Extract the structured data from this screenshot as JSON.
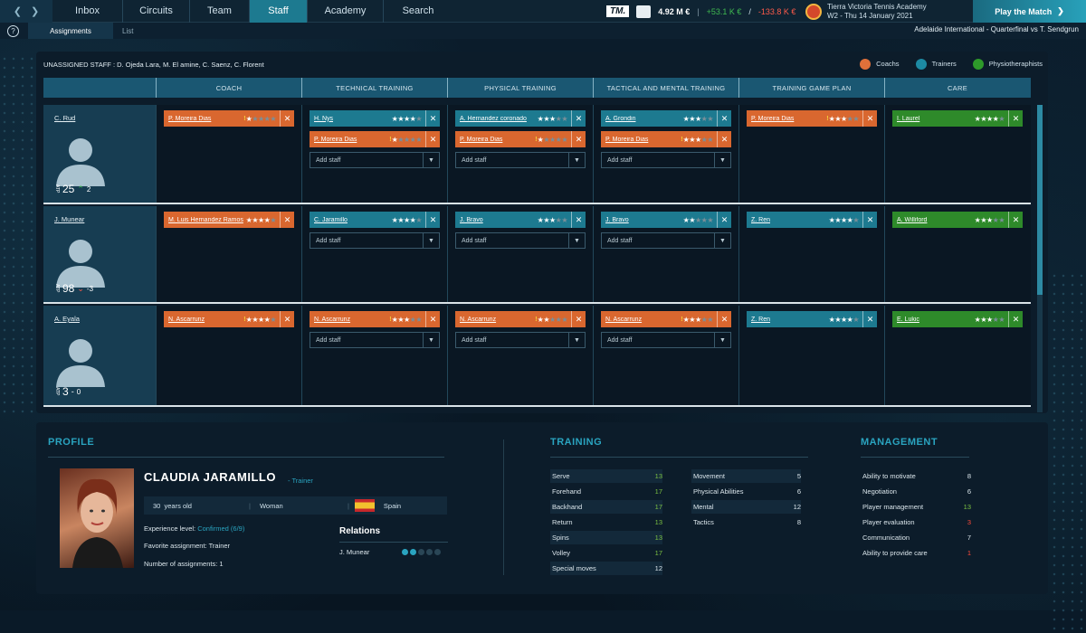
{
  "nav": {
    "tabs": [
      "Inbox",
      "Circuits",
      "Team",
      "Staff",
      "Academy",
      "Search"
    ],
    "active": "Staff"
  },
  "finance": {
    "logo": "TM.",
    "balance": "4.92 M €",
    "gain": "+53.1 K €",
    "separator": "/",
    "loss": "-133.8 K €"
  },
  "academy": {
    "name": "Tierra Victoria Tennis Academy",
    "date": "W2 - Thu 14 January 2021"
  },
  "play_button": "Play the Match",
  "subnav": {
    "help": "?",
    "tabs": [
      "Assignments",
      "List"
    ],
    "active": "Assignments"
  },
  "match_info": "Adelaide International - Quarterfinal vs T. Sendgrun",
  "unassigned": "UNASSIGNED STAFF : D. Ojeda Lara, M. El amine, C. Saenz, C. Florent",
  "legend": [
    {
      "label": "Coachs",
      "color": "#e0703a"
    },
    {
      "label": "Trainers",
      "color": "#1d8aa3"
    },
    {
      "label": "Physiotheraphists",
      "color": "#2e9a2a"
    }
  ],
  "columns": [
    "COACH",
    "TECHNICAL TRAINING",
    "PHYSICAL TRAINING",
    "TACTICAL AND MENTAL TRAINING",
    "TRAINING GAME PLAN",
    "CARE"
  ],
  "add_staff": "Add staff",
  "players": [
    {
      "name": "C. Rud",
      "rank_label": "ATP",
      "rank": "25",
      "change": "2",
      "trend": "up",
      "cells": [
        [
          {
            "name": "P. Moreira Dias",
            "type": "c",
            "warn": true,
            "stars": "★",
            "empty": "★★★★"
          }
        ],
        [
          {
            "name": "H. Nys",
            "type": "t",
            "warn": false,
            "stars": "★★★★",
            "empty": "★"
          },
          {
            "name": "P. Moreira Dias",
            "type": "c",
            "warn": true,
            "stars": "★",
            "empty": "★★★★"
          },
          {
            "add": true
          }
        ],
        [
          {
            "name": "A. Hernandez coronado",
            "type": "t",
            "warn": false,
            "stars": "★★★",
            "empty": "★★"
          },
          {
            "name": "P. Moreira Dias",
            "type": "c",
            "warn": true,
            "stars": "★",
            "empty": "★★★★"
          },
          {
            "add": true
          }
        ],
        [
          {
            "name": "A. Grondin",
            "type": "t",
            "warn": false,
            "stars": "★★★",
            "empty": "★★"
          },
          {
            "name": "P. Moreira Dias",
            "type": "c",
            "warn": true,
            "stars": "★★★",
            "empty": "★★"
          },
          {
            "add": true
          }
        ],
        [
          {
            "name": "P. Moreira Dias",
            "type": "c",
            "warn": true,
            "stars": "★★★",
            "empty": "★★"
          }
        ],
        [
          {
            "name": "I. Laurel",
            "type": "p",
            "warn": false,
            "stars": "★★★★",
            "empty": "★"
          }
        ]
      ]
    },
    {
      "name": "J. Munear",
      "rank_label": "ATP",
      "rank": "98",
      "change": "-3",
      "trend": "down",
      "cells": [
        [
          {
            "name": "M. Luis Hernandez Ramos",
            "type": "c",
            "warn": false,
            "stars": "★★★★",
            "empty": "★"
          }
        ],
        [
          {
            "name": "C. Jaramillo",
            "type": "t",
            "warn": false,
            "stars": "★★★★",
            "empty": "★"
          },
          {
            "add": true
          }
        ],
        [
          {
            "name": "J. Bravo",
            "type": "t",
            "warn": false,
            "stars": "★★★",
            "empty": "★★"
          },
          {
            "add": true
          }
        ],
        [
          {
            "name": "J. Bravo",
            "type": "t",
            "warn": false,
            "stars": "★★",
            "empty": "★★★"
          },
          {
            "add": true
          }
        ],
        [
          {
            "name": "Z. Ren",
            "type": "t",
            "warn": false,
            "stars": "★★★★",
            "empty": "★"
          }
        ],
        [
          {
            "name": "A. Williford",
            "type": "p",
            "warn": false,
            "stars": "★★★",
            "empty": "★★"
          }
        ]
      ]
    },
    {
      "name": "A. Eyala",
      "rank_label": "ATP",
      "rank": "3",
      "change": "0",
      "trend": "none",
      "cells": [
        [
          {
            "name": "N. Ascarrunz",
            "type": "c",
            "warn": true,
            "stars": "★★★★",
            "empty": "★"
          }
        ],
        [
          {
            "name": "N. Ascarrunz",
            "type": "c",
            "warn": true,
            "stars": "★★★",
            "empty": "★★"
          },
          {
            "add": true
          }
        ],
        [
          {
            "name": "N. Ascarrunz",
            "type": "c",
            "warn": true,
            "stars": "★★",
            "empty": "★★★"
          },
          {
            "add": true
          }
        ],
        [
          {
            "name": "N. Ascarrunz",
            "type": "c",
            "warn": true,
            "stars": "★★★",
            "empty": "★★"
          },
          {
            "add": true
          }
        ],
        [
          {
            "name": "Z. Ren",
            "type": "t",
            "warn": false,
            "stars": "★★★★",
            "empty": "★"
          }
        ],
        [
          {
            "name": "E. Lukic",
            "type": "p",
            "warn": false,
            "stars": "★★★",
            "empty": "★★"
          }
        ]
      ]
    }
  ],
  "profile": {
    "section": "PROFILE",
    "name": "CLAUDIA JARAMILLO",
    "role": "- Trainer",
    "age": "30",
    "age_label": "years old",
    "gender": "Woman",
    "country": "Spain",
    "experience_label": "Experience level:",
    "experience_value": "Confirmed (6/9)",
    "fav_label": "Favorite assignment:",
    "fav_value": "Trainer",
    "assign_label": "Number of assignments:",
    "assign_value": "1",
    "relations_title": "Relations",
    "relation_name": "J. Munear",
    "relation_level": 2
  },
  "training": {
    "section": "TRAINING",
    "left": [
      [
        "Serve",
        "13"
      ],
      [
        "Forehand",
        "17"
      ],
      [
        "Backhand",
        "17"
      ],
      [
        "Return",
        "13"
      ],
      [
        "Spins",
        "13"
      ],
      [
        "Volley",
        "17"
      ],
      [
        "Special moves",
        "12"
      ]
    ],
    "right": [
      [
        "Movement",
        "5"
      ],
      [
        "Physical Abilities",
        "6"
      ],
      [
        "Mental",
        "12"
      ],
      [
        "Tactics",
        "8"
      ]
    ]
  },
  "management": {
    "section": "MANAGEMENT",
    "items": [
      [
        "Ability to motivate",
        "8"
      ],
      [
        "Negotiation",
        "6"
      ],
      [
        "Player management",
        "13"
      ],
      [
        "Player evaluation",
        "3"
      ],
      [
        "Communication",
        "7"
      ],
      [
        "Ability to provide care",
        "1"
      ]
    ]
  },
  "colors": {
    "high": "#7cc242",
    "mid": "#dbe6ec",
    "low": "#ff4a3a",
    "accent": "#2aa4c0"
  }
}
